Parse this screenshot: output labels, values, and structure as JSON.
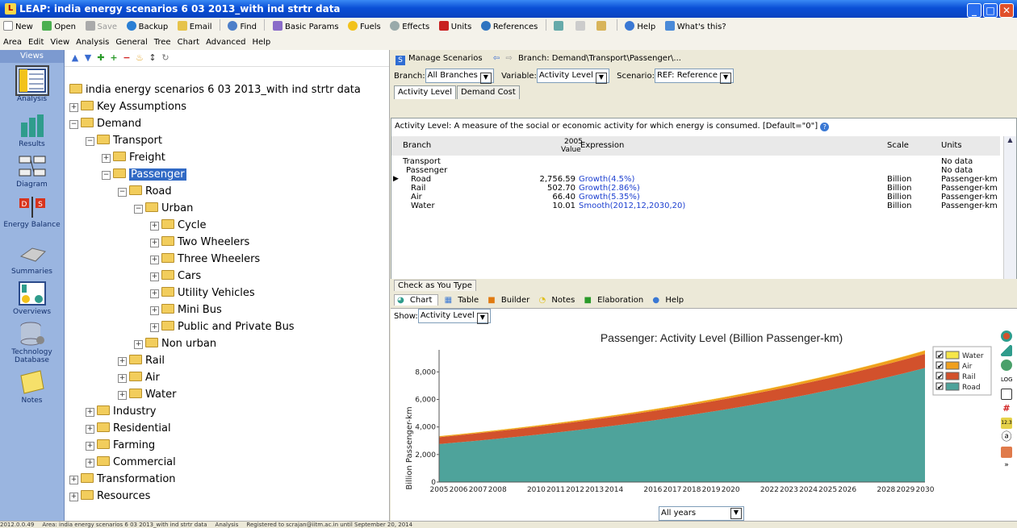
{
  "window": {
    "title": "LEAP: india energy scenarios 6 03 2013_with ind strtr data"
  },
  "toolbar": [
    "New",
    "Open",
    "Save",
    "Backup",
    "Email",
    "Find",
    "Basic Params",
    "Fuels",
    "Effects",
    "Units",
    "References",
    "Help",
    "What's this?"
  ],
  "menu": [
    "Area",
    "Edit",
    "View",
    "Analysis",
    "General",
    "Tree",
    "Chart",
    "Advanced",
    "Help"
  ],
  "views": {
    "header": "Views",
    "items": [
      "Analysis",
      "Results",
      "Diagram",
      "Energy Balance",
      "Summaries",
      "Overviews",
      "Technology Database",
      "Notes"
    ]
  },
  "tree": {
    "root": "india energy scenarios 6 03 2013_with ind strtr data",
    "nodes": [
      "Key Assumptions",
      "Demand",
      "Transport",
      "Freight",
      "Passenger",
      "Road",
      "Urban",
      "Cycle",
      "Two Wheelers",
      "Three Wheelers",
      "Cars",
      "Utility Vehicles",
      "Mini Bus",
      "Public and Private Bus",
      "Non urban",
      "Rail",
      "Air",
      "Water",
      "Industry",
      "Residential",
      "Farming",
      "Commercial",
      "Transformation",
      "Resources"
    ]
  },
  "header": {
    "manage": "Manage Scenarios",
    "branch_path": "Branch: Demand\\Transport\\Passenger\\..."
  },
  "selectors": {
    "branch_label": "Branch:",
    "branch": "All Branches",
    "variable_label": "Variable:",
    "variable": "Activity Level",
    "scenario_label": "Scenario:",
    "scenario": "REF: Reference"
  },
  "tabs": [
    "Activity Level",
    "Demand Cost"
  ],
  "description": "Activity Level: A measure of the social or economic activity for which energy is consumed. [Default=\"0\"]",
  "grid": {
    "headers": {
      "branch": "Branch",
      "year": "2005",
      "value": "Value",
      "expression": "Expression",
      "scale": "Scale",
      "units": "Units"
    },
    "rows": [
      {
        "branch": "Transport",
        "value": "",
        "expr": "",
        "scale": "",
        "units": "No data"
      },
      {
        "branch": "Passenger",
        "value": "",
        "expr": "",
        "scale": "",
        "units": "No data"
      },
      {
        "branch": "Road",
        "value": "2,756.59",
        "expr": "Growth(4.5%)",
        "scale": "Billion",
        "units": "Passenger-km"
      },
      {
        "branch": "Rail",
        "value": "502.70",
        "expr": "Growth(2.86%)",
        "scale": "Billion",
        "units": "Passenger-km"
      },
      {
        "branch": "Air",
        "value": "66.40",
        "expr": "Growth(5.35%)",
        "scale": "Billion",
        "units": "Passenger-km"
      },
      {
        "branch": "Water",
        "value": "10.01",
        "expr": "Smooth(2012,12,2030,20)",
        "scale": "Billion",
        "units": "Passenger-km"
      }
    ]
  },
  "bottom": {
    "check_tab": "Check as You Type",
    "tabs": [
      "Chart",
      "Table",
      "Builder",
      "Notes",
      "Elaboration",
      "Help"
    ],
    "show_label": "Show:",
    "show_value": "Activity Level",
    "years_value": "All years"
  },
  "chart_data": {
    "type": "area",
    "title": "Passenger: Activity Level (Billion Passenger-km)",
    "ylabel": "Billion Passenger-km",
    "xlabel": "",
    "x": [
      2005,
      2006,
      2007,
      2008,
      2009,
      2010,
      2011,
      2012,
      2013,
      2014,
      2015,
      2016,
      2017,
      2018,
      2019,
      2020,
      2021,
      2022,
      2023,
      2024,
      2025,
      2026,
      2027,
      2028,
      2029,
      2030
    ],
    "ylim": [
      0,
      9600
    ],
    "yticks": [
      0,
      2000,
      4000,
      6000,
      8000
    ],
    "ytick_labels": [
      "0",
      "2,000",
      "4,000",
      "6,000",
      "8,000"
    ],
    "xtick_labels": [
      "2005",
      "2006",
      "2007",
      "2008",
      "2010",
      "2011",
      "2012",
      "2013",
      "2014",
      "2016",
      "2017",
      "2018",
      "2019",
      "2020",
      "2022",
      "2023",
      "2024",
      "2025",
      "2026",
      "2028",
      "2029",
      "2030"
    ],
    "stacked": true,
    "legend": "top-right",
    "series": [
      {
        "name": "Road",
        "color": "#4ea39b",
        "start": 2756.59,
        "rate": 0.045
      },
      {
        "name": "Rail",
        "color": "#d2512c",
        "start": 502.7,
        "rate": 0.0286
      },
      {
        "name": "Air",
        "color": "#f0a01e",
        "start": 66.4,
        "rate": 0.0535
      },
      {
        "name": "Water",
        "color": "#f6e64a",
        "start": 10.01,
        "rate": 0.03
      }
    ]
  },
  "status": [
    "2012.0.0.49",
    "Area: india energy scenarios 6 03 2013_with ind strtr data",
    "Analysis",
    "Registered to scrajan@iitm.ac.in until September 20, 2014"
  ]
}
